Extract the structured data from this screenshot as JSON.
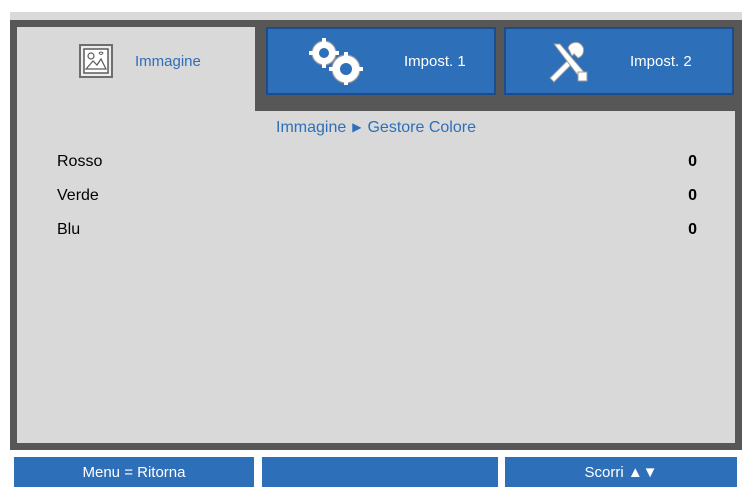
{
  "tabs": [
    {
      "label": "Immagine",
      "icon": "picture-icon",
      "active": true
    },
    {
      "label": "Impost. 1",
      "icon": "gears-icon",
      "active": false
    },
    {
      "label": "Impost. 2",
      "icon": "tools-icon",
      "active": false
    }
  ],
  "breadcrumb": {
    "parent": "Immagine",
    "current": "Gestore Colore"
  },
  "settings": [
    {
      "label": "Rosso",
      "value": "0"
    },
    {
      "label": "Verde",
      "value": "0"
    },
    {
      "label": "Blu",
      "value": "0"
    }
  ],
  "footer": {
    "left": "Menu = Ritorna",
    "middle": "",
    "right": "Scorri ▲▼"
  },
  "colors": {
    "accent": "#2e6fb9",
    "panel": "#d9d9d9",
    "frame": "#575757"
  }
}
